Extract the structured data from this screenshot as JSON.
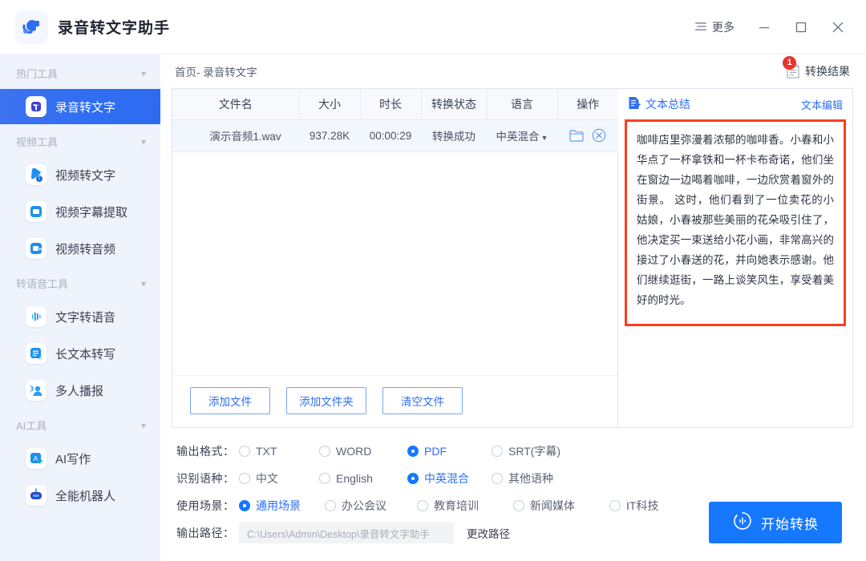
{
  "window": {
    "app_title": "录音转文字助手",
    "logo_icon": "app-logo-icon",
    "more_label": "更多",
    "more_icon": "hamburger-icon",
    "minimize_icon": "minimize-icon",
    "maximize_icon": "maximize-icon",
    "close_icon": "close-icon"
  },
  "sidebar": {
    "groups": [
      {
        "label": "热门工具",
        "items": [
          {
            "label": "录音转文字",
            "icon": "audio-to-text-icon",
            "active": true
          }
        ]
      },
      {
        "label": "视频工具",
        "items": [
          {
            "label": "视频转文字",
            "icon": "video-to-text-icon",
            "active": false
          },
          {
            "label": "视频字幕提取",
            "icon": "video-subtitle-extract-icon",
            "active": false
          },
          {
            "label": "视频转音频",
            "icon": "video-to-audio-icon",
            "active": false
          }
        ]
      },
      {
        "label": "转语音工具",
        "items": [
          {
            "label": "文字转语音",
            "icon": "text-to-speech-icon",
            "active": false
          },
          {
            "label": "长文本转写",
            "icon": "long-text-transcribe-icon",
            "active": false
          },
          {
            "label": "多人播报",
            "icon": "multi-speaker-icon",
            "active": false
          }
        ]
      },
      {
        "label": "AI工具",
        "items": [
          {
            "label": "AI写作",
            "icon": "ai-writing-icon",
            "active": false
          },
          {
            "label": "全能机器人",
            "icon": "robot-icon",
            "active": false
          }
        ]
      }
    ]
  },
  "main": {
    "breadcrumb": "首页- 录音转文字",
    "result_button": {
      "label": "转换结果",
      "badge": "1",
      "icon": "document-icon"
    },
    "table": {
      "columns": [
        "文件名",
        "大小",
        "时长",
        "转换状态",
        "语言",
        "操作"
      ],
      "rows": [
        {
          "filename": "演示音频1.wav",
          "size": "937.28K",
          "duration": "00:00:29",
          "status": "转换成功",
          "language": "中英混合",
          "language_caret": "▼",
          "actions": [
            "folder-icon",
            "remove-circle-icon"
          ]
        }
      ]
    },
    "table_buttons": [
      "添加文件",
      "添加文件夹",
      "清空文件"
    ],
    "text_panel": {
      "title": "文本总结",
      "title_icon": "summary-doc-icon",
      "edit_label": "文本编辑",
      "content": "咖啡店里弥漫着浓郁的咖啡香。小春和小华点了一杯拿铁和一杯卡布奇诺，他们坐在窗边一边喝着咖啡，一边欣赏着窗外的街景。 这时，他们看到了一位卖花的小姑娘，小春被那些美丽的花朵吸引住了，他决定买一束送给小花小画，非常高兴的接过了小春送的花，并向她表示感谢。他们继续逛街，一路上谈笑风生，享受着美好的时光。"
    }
  },
  "options": {
    "rows": [
      {
        "label": "输出格式：",
        "name": "output-format",
        "choices": [
          {
            "label": "TXT",
            "selected": false
          },
          {
            "label": "WORD",
            "selected": false
          },
          {
            "label": "PDF",
            "selected": true
          },
          {
            "label": "SRT(字幕)",
            "selected": false
          }
        ]
      },
      {
        "label": "识别语种：",
        "name": "recognize-language",
        "choices": [
          {
            "label": "中文",
            "selected": false
          },
          {
            "label": "English",
            "selected": false
          },
          {
            "label": "中英混合",
            "selected": true
          },
          {
            "label": "其他语种",
            "selected": false
          }
        ]
      },
      {
        "label": "使用场景：",
        "name": "use-scenario",
        "choices": [
          {
            "label": "通用场景",
            "selected": true
          },
          {
            "label": "办公会议",
            "selected": false
          },
          {
            "label": "教育培训",
            "selected": false
          },
          {
            "label": "新闻媒体",
            "selected": false
          },
          {
            "label": "IT科技",
            "selected": false
          }
        ]
      }
    ],
    "output_path": {
      "label": "输出路径：",
      "value": "C:\\Users\\Admin\\Desktop\\录音转文字助手",
      "change_label": "更改路径"
    },
    "start_button": {
      "label": "开始转换",
      "icon": "convert-icon"
    }
  },
  "colors": {
    "accent": "#1677ff",
    "sidebar_bg": "#eef3fc",
    "active_item": "#2f6ef2",
    "badge_red": "#e8342a",
    "highlight_border": "#fc3d1c"
  }
}
